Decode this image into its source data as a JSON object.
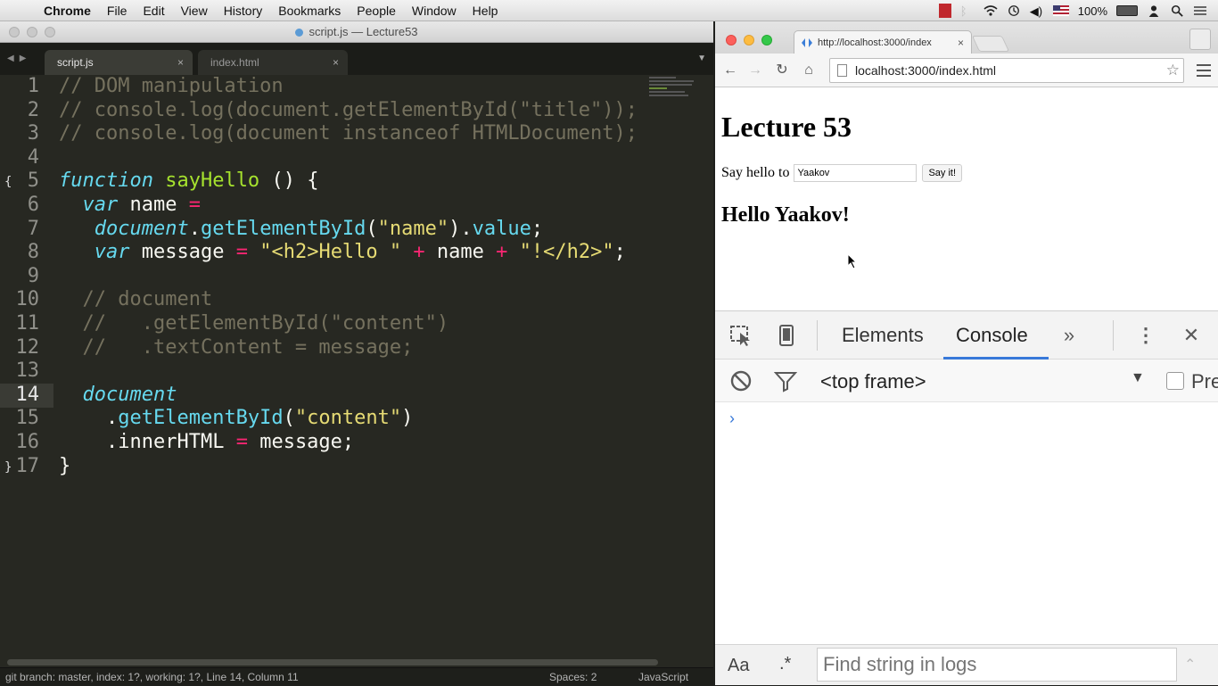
{
  "menubar": {
    "app": "Chrome",
    "items": [
      "File",
      "Edit",
      "View",
      "History",
      "Bookmarks",
      "People",
      "Window",
      "Help"
    ],
    "battery": "100%"
  },
  "sublime": {
    "window_title": "script.js — Lecture53",
    "tabs": [
      {
        "label": "script.js",
        "active": true
      },
      {
        "label": "index.html",
        "active": false
      }
    ],
    "code_lines": [
      "// DOM manipulation",
      "// console.log(document.getElementById(\"title\"));",
      "// console.log(document instanceof HTMLDocument);",
      "",
      "function sayHello () {",
      "  var name =",
      "   document.getElementById(\"name\").value;",
      "   var message = \"<h2>Hello \" + name + \"!</h2>\";",
      "",
      "  // document",
      "  //   .getElementById(\"content\")",
      "  //   .textContent = message;",
      "",
      "  document",
      "    .getElementById(\"content\")",
      "    .innerHTML = message;",
      "}"
    ],
    "line_numbers": [
      "1",
      "2",
      "3",
      "4",
      "5",
      "6",
      "7",
      "8",
      "9",
      "10",
      "11",
      "12",
      "13",
      "14",
      "15",
      "16",
      "17"
    ],
    "current_line": 14,
    "status": {
      "left": "git branch: master, index: 1?, working: 1?, Line 14, Column 11",
      "spaces": "Spaces: 2",
      "syntax": "JavaScript"
    }
  },
  "chrome": {
    "tab_title": "http://localhost:3000/index",
    "url": "localhost:3000/index.html",
    "page": {
      "heading": "Lecture 53",
      "say_label": "Say hello to",
      "name_value": "Yaakov",
      "button_label": "Say it!",
      "content": "Hello Yaakov!"
    },
    "devtools": {
      "tabs": [
        "Elements",
        "Console"
      ],
      "active_tab": "Console",
      "more": "»",
      "frame": "<top frame>",
      "preserve_label": "Pre",
      "prompt": "›",
      "aa": "Aa",
      "regex": ".*",
      "find_placeholder": "Find string in logs"
    }
  },
  "colors": {
    "editor_bg": "#272822",
    "comment": "#75715e",
    "keyword": "#66d9ef",
    "function": "#a6e22e",
    "operator": "#f92672",
    "string": "#e6db74",
    "devtools_accent": "#3879d9"
  }
}
